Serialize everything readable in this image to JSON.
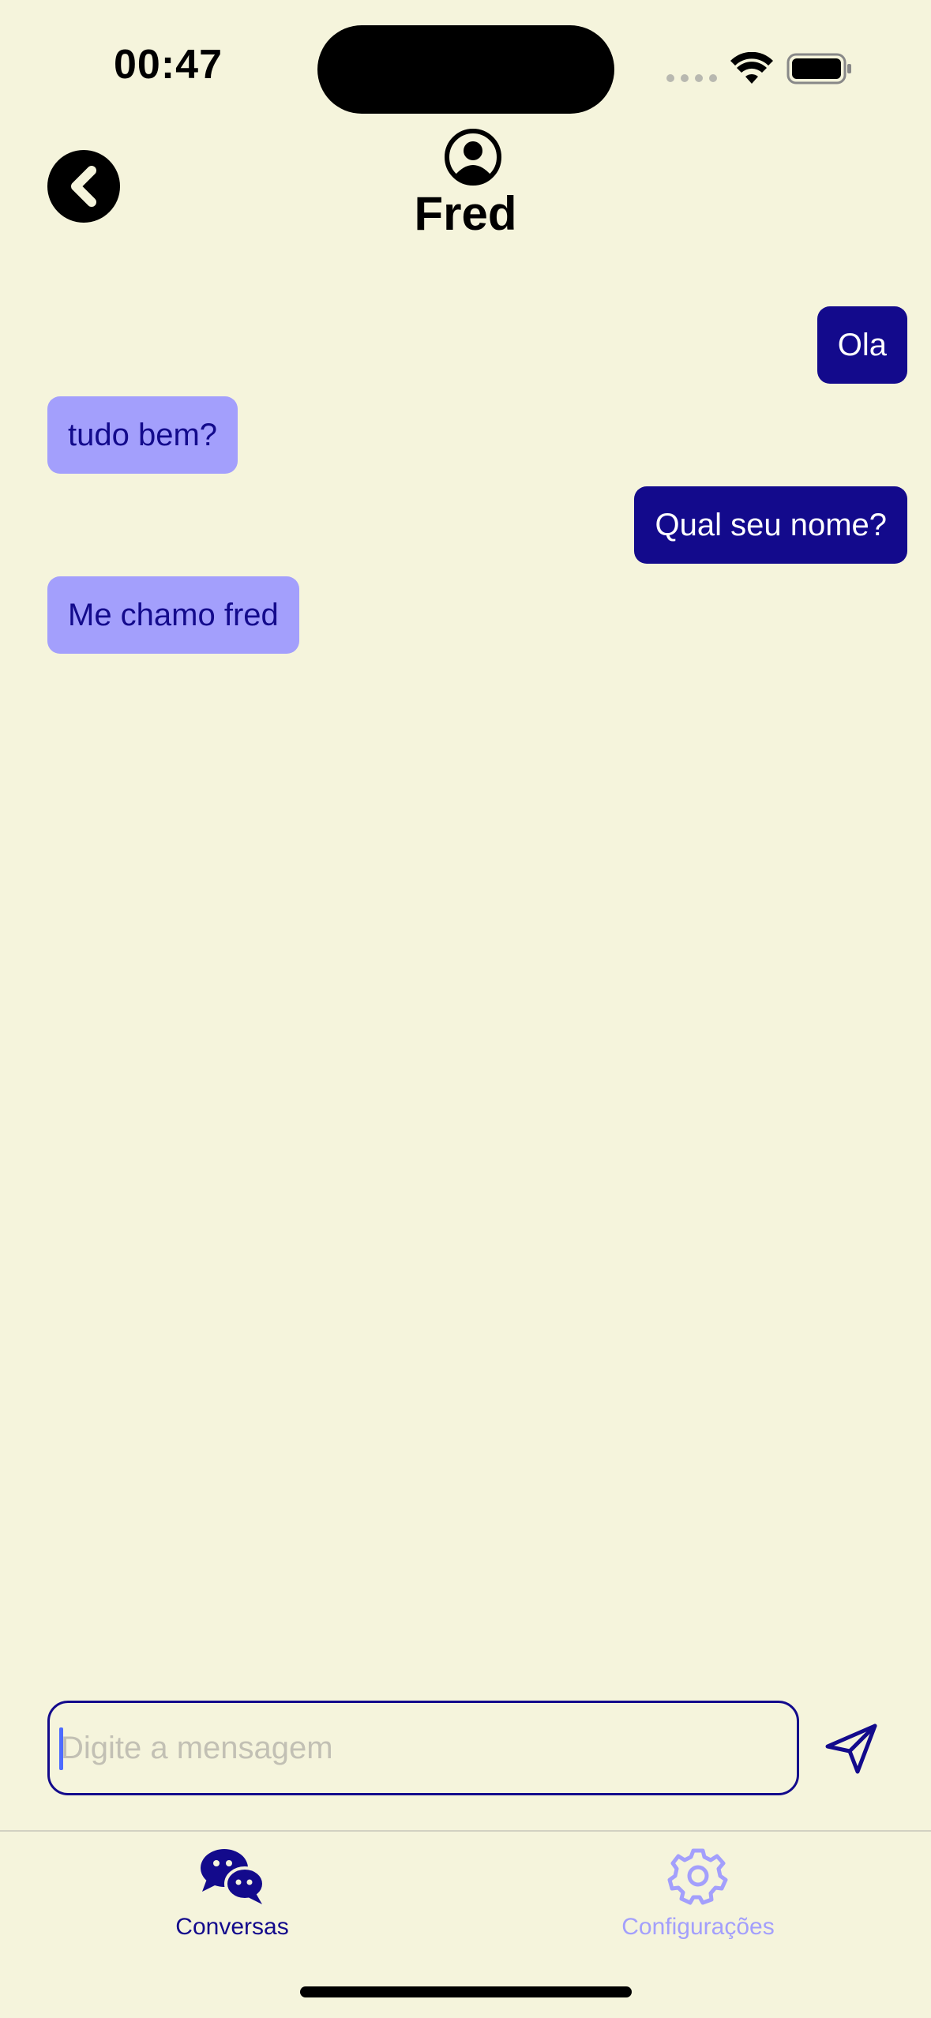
{
  "status_bar": {
    "time": "00:47"
  },
  "header": {
    "contact_name": "Fred",
    "avatar_icon": "person-circle-icon",
    "back_icon": "chevron-left-icon"
  },
  "messages": [
    {
      "text": "Ola",
      "direction": "sent"
    },
    {
      "text": "tudo bem?",
      "direction": "received"
    },
    {
      "text": "Qual seu nome?",
      "direction": "sent"
    },
    {
      "text": "Me chamo fred",
      "direction": "received"
    }
  ],
  "composer": {
    "placeholder": "Digite a mensagem",
    "value": "",
    "send_icon": "paper-plane-icon"
  },
  "tabs": [
    {
      "label": "Conversas",
      "icon": "chat-bubbles-icon",
      "active": true
    },
    {
      "label": "Configurações",
      "icon": "gear-icon",
      "active": false
    }
  ],
  "colors": {
    "background": "#f5f4dc",
    "primary": "#130a8c",
    "received_bubble": "#a39ffc",
    "inactive_tab": "#a39ffc"
  }
}
